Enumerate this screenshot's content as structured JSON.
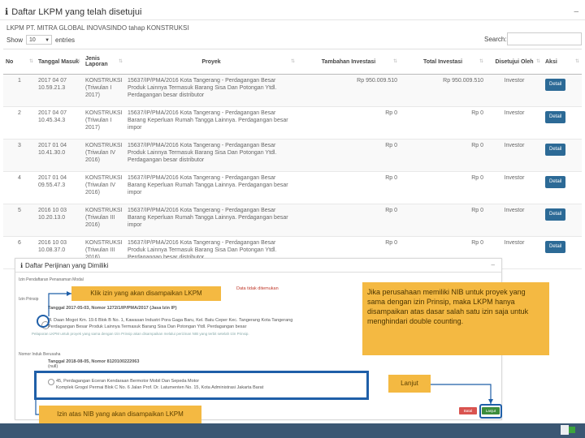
{
  "panel": {
    "icon": "info-icon",
    "title": "Daftar LKPM yang telah disetujui",
    "subtitle": "LKPM PT. MITRA GLOBAL INOVASINDO tahap KONSTRUKSI",
    "show_label": "Show",
    "show_value": "10",
    "entries_label": "entries",
    "search_label": "Search:"
  },
  "table": {
    "headers": [
      "No",
      "Tanggal Masuk",
      "Jenis Laporan",
      "Proyek",
      "Tambahan Investasi",
      "Total Investasi",
      "Disetujui Oleh",
      "Aksi"
    ],
    "rows": [
      {
        "no": "1",
        "tanggal": "2017 04 07 10.59.21.3",
        "jenis": "KONSTRUKSI (Triwulan I 2017)",
        "proyek": "15637/IP/PMA/2016 Kota Tangerang - Perdagangan Besar Produk Lainnya Termasuk Barang Sisa Dan Potongan Ytdl. Perdagangan besar distributor",
        "tambahan": "Rp 950.009.510",
        "total": "Rp 950.009.510",
        "oleh": "Investor",
        "aksi": "Detail"
      },
      {
        "no": "2",
        "tanggal": "2017 04 07 10.45.34.3",
        "jenis": "KONSTRUKSI (Triwulan I 2017)",
        "proyek": "15637/IP/PMA/2016 Kota Tangerang - Perdagangan Besar Barang Keperluan Rumah Tangga Lainnya. Perdagangan besar impor",
        "tambahan": "Rp 0",
        "total": "Rp 0",
        "oleh": "Investor",
        "aksi": "Detail"
      },
      {
        "no": "3",
        "tanggal": "2017 01 04 10.41.30.0",
        "jenis": "KONSTRUKSI (Triwulan IV 2016)",
        "proyek": "15637/IP/PMA/2016 Kota Tangerang - Perdagangan Besar Produk Lainnya Termasuk Barang Sisa Dan Potongan Ytdl. Perdagangan besar distributor",
        "tambahan": "Rp 0",
        "total": "Rp 0",
        "oleh": "Investor",
        "aksi": "Detail"
      },
      {
        "no": "4",
        "tanggal": "2017 01 04 09.55.47.3",
        "jenis": "KONSTRUKSI (Triwulan IV 2016)",
        "proyek": "15637/IP/PMA/2016 Kota Tangerang - Perdagangan Besar Barang Keperluan Rumah Tangga Lainnya. Perdagangan besar impor",
        "tambahan": "Rp 0",
        "total": "Rp 0",
        "oleh": "Investor",
        "aksi": "Detail"
      },
      {
        "no": "5",
        "tanggal": "2016 10 03 10.20.13.0",
        "jenis": "KONSTRUKSI (Triwulan III 2016)",
        "proyek": "15637/IP/PMA/2016 Kota Tangerang - Perdagangan Besar Barang Keperluan Rumah Tangga Lainnya. Perdagangan besar impor",
        "tambahan": "Rp 0",
        "total": "Rp 0",
        "oleh": "Investor",
        "aksi": "Detail"
      },
      {
        "no": "6",
        "tanggal": "2016 10 03 10.08.37.0",
        "jenis": "KONSTRUKSI (Triwulan III 2016)",
        "proyek": "15637/IP/PMA/2016 Kota Tangerang - Perdagangan Besar Produk Lainnya Termasuk Barang Sisa Dan Potongan Ytdl. Perdagangan besar distributor",
        "tambahan": "Rp 0",
        "total": "Rp 0",
        "oleh": "Investor",
        "aksi": "Detail"
      }
    ]
  },
  "embed": {
    "title": "Daftar Perijinan yang Dimiliki",
    "section1": "Izin Pendaftaran Penanaman Modal",
    "warning": "Data tidak ditemukan",
    "section2": "Izin Prinsip",
    "izin_line1": "Tanggal 2017-05-03, Nomor 1272/1/IP/PMA/2017 (Jasa Izin IP)",
    "izin_line2": "Jl. Daan Mogot Km. 19.6 Blok B No. 1, Kawasan Industri Pora Gaga Baru, Kel. Batu Ceper Kec. Tangerang Kota Tangerang",
    "izin_line3": "Perdagangan Besar Produk Lainnya Termasuk Barang Sisa Dan Potongan Ytdl. Perdagangan besar",
    "note": "Pelaporan LKPM untuk proyek yang sama dengan Izin Prinsip akan disampaikan melalui perizinan NIB yang terbit setelah Izin Prinsip.",
    "section3": "Nomor Induk Berusaha",
    "nib_line1": "Tanggal 2018-08-05, Nomor 8120100222063",
    "nib_line2": "(null)",
    "nib_line3": "45, Perdagangan Eceran Kendaraan Bermotor Mobil Dan Sepeda Motor",
    "nib_line4": "Komplek Grogol Permai Blok C No. 6 Jalan Prof. Dr. Latumenten No. 15, Kota Administrasi Jakarta Barat",
    "batal_label": "Batal",
    "lanjut_small_label": "Lanjut"
  },
  "callouts": {
    "klik": "Klik izin yang akan disampaikan LKPM",
    "jika": "Jika perusahaan memiliki NIB untuk proyek yang sama dengan izin Prinsip, maka LKPM hanya disampaikan atas dasar salah satu izin saja untuk menghindari double counting.",
    "lanjut": "Lanjut",
    "izin_nib": "Izin atas NIB yang akan disampaikan LKPM"
  },
  "colors": {
    "callout": "#f4b942",
    "highlight": "#1f5fa8",
    "detail_button": "#2c6a96",
    "footer": "#3b5773"
  }
}
